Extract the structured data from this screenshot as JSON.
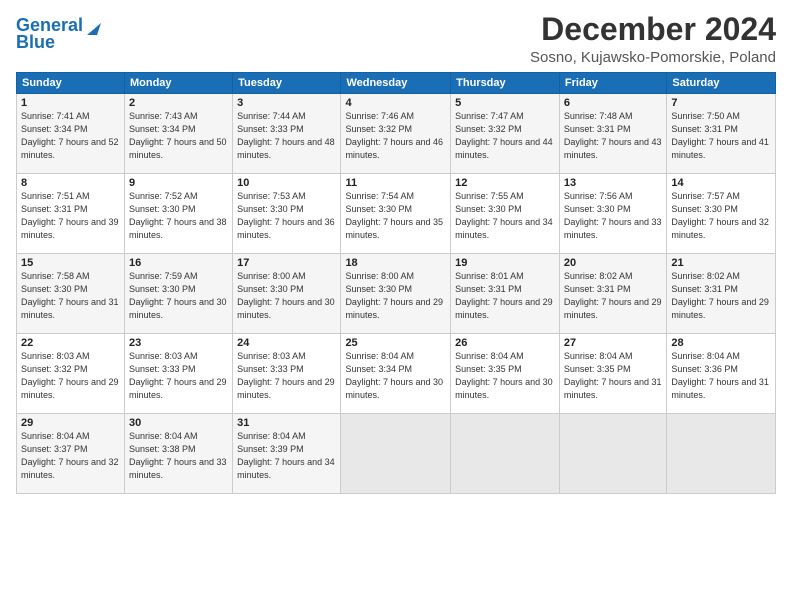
{
  "header": {
    "logo_line1": "General",
    "logo_line2": "Blue",
    "title": "December 2024",
    "subtitle": "Sosno, Kujawsko-Pomorskie, Poland"
  },
  "weekdays": [
    "Sunday",
    "Monday",
    "Tuesday",
    "Wednesday",
    "Thursday",
    "Friday",
    "Saturday"
  ],
  "weeks": [
    [
      {
        "day": "1",
        "sunrise": "Sunrise: 7:41 AM",
        "sunset": "Sunset: 3:34 PM",
        "daylight": "Daylight: 7 hours and 52 minutes."
      },
      {
        "day": "2",
        "sunrise": "Sunrise: 7:43 AM",
        "sunset": "Sunset: 3:34 PM",
        "daylight": "Daylight: 7 hours and 50 minutes."
      },
      {
        "day": "3",
        "sunrise": "Sunrise: 7:44 AM",
        "sunset": "Sunset: 3:33 PM",
        "daylight": "Daylight: 7 hours and 48 minutes."
      },
      {
        "day": "4",
        "sunrise": "Sunrise: 7:46 AM",
        "sunset": "Sunset: 3:32 PM",
        "daylight": "Daylight: 7 hours and 46 minutes."
      },
      {
        "day": "5",
        "sunrise": "Sunrise: 7:47 AM",
        "sunset": "Sunset: 3:32 PM",
        "daylight": "Daylight: 7 hours and 44 minutes."
      },
      {
        "day": "6",
        "sunrise": "Sunrise: 7:48 AM",
        "sunset": "Sunset: 3:31 PM",
        "daylight": "Daylight: 7 hours and 43 minutes."
      },
      {
        "day": "7",
        "sunrise": "Sunrise: 7:50 AM",
        "sunset": "Sunset: 3:31 PM",
        "daylight": "Daylight: 7 hours and 41 minutes."
      }
    ],
    [
      {
        "day": "8",
        "sunrise": "Sunrise: 7:51 AM",
        "sunset": "Sunset: 3:31 PM",
        "daylight": "Daylight: 7 hours and 39 minutes."
      },
      {
        "day": "9",
        "sunrise": "Sunrise: 7:52 AM",
        "sunset": "Sunset: 3:30 PM",
        "daylight": "Daylight: 7 hours and 38 minutes."
      },
      {
        "day": "10",
        "sunrise": "Sunrise: 7:53 AM",
        "sunset": "Sunset: 3:30 PM",
        "daylight": "Daylight: 7 hours and 36 minutes."
      },
      {
        "day": "11",
        "sunrise": "Sunrise: 7:54 AM",
        "sunset": "Sunset: 3:30 PM",
        "daylight": "Daylight: 7 hours and 35 minutes."
      },
      {
        "day": "12",
        "sunrise": "Sunrise: 7:55 AM",
        "sunset": "Sunset: 3:30 PM",
        "daylight": "Daylight: 7 hours and 34 minutes."
      },
      {
        "day": "13",
        "sunrise": "Sunrise: 7:56 AM",
        "sunset": "Sunset: 3:30 PM",
        "daylight": "Daylight: 7 hours and 33 minutes."
      },
      {
        "day": "14",
        "sunrise": "Sunrise: 7:57 AM",
        "sunset": "Sunset: 3:30 PM",
        "daylight": "Daylight: 7 hours and 32 minutes."
      }
    ],
    [
      {
        "day": "15",
        "sunrise": "Sunrise: 7:58 AM",
        "sunset": "Sunset: 3:30 PM",
        "daylight": "Daylight: 7 hours and 31 minutes."
      },
      {
        "day": "16",
        "sunrise": "Sunrise: 7:59 AM",
        "sunset": "Sunset: 3:30 PM",
        "daylight": "Daylight: 7 hours and 30 minutes."
      },
      {
        "day": "17",
        "sunrise": "Sunrise: 8:00 AM",
        "sunset": "Sunset: 3:30 PM",
        "daylight": "Daylight: 7 hours and 30 minutes."
      },
      {
        "day": "18",
        "sunrise": "Sunrise: 8:00 AM",
        "sunset": "Sunset: 3:30 PM",
        "daylight": "Daylight: 7 hours and 29 minutes."
      },
      {
        "day": "19",
        "sunrise": "Sunrise: 8:01 AM",
        "sunset": "Sunset: 3:31 PM",
        "daylight": "Daylight: 7 hours and 29 minutes."
      },
      {
        "day": "20",
        "sunrise": "Sunrise: 8:02 AM",
        "sunset": "Sunset: 3:31 PM",
        "daylight": "Daylight: 7 hours and 29 minutes."
      },
      {
        "day": "21",
        "sunrise": "Sunrise: 8:02 AM",
        "sunset": "Sunset: 3:31 PM",
        "daylight": "Daylight: 7 hours and 29 minutes."
      }
    ],
    [
      {
        "day": "22",
        "sunrise": "Sunrise: 8:03 AM",
        "sunset": "Sunset: 3:32 PM",
        "daylight": "Daylight: 7 hours and 29 minutes."
      },
      {
        "day": "23",
        "sunrise": "Sunrise: 8:03 AM",
        "sunset": "Sunset: 3:33 PM",
        "daylight": "Daylight: 7 hours and 29 minutes."
      },
      {
        "day": "24",
        "sunrise": "Sunrise: 8:03 AM",
        "sunset": "Sunset: 3:33 PM",
        "daylight": "Daylight: 7 hours and 29 minutes."
      },
      {
        "day": "25",
        "sunrise": "Sunrise: 8:04 AM",
        "sunset": "Sunset: 3:34 PM",
        "daylight": "Daylight: 7 hours and 30 minutes."
      },
      {
        "day": "26",
        "sunrise": "Sunrise: 8:04 AM",
        "sunset": "Sunset: 3:35 PM",
        "daylight": "Daylight: 7 hours and 30 minutes."
      },
      {
        "day": "27",
        "sunrise": "Sunrise: 8:04 AM",
        "sunset": "Sunset: 3:35 PM",
        "daylight": "Daylight: 7 hours and 31 minutes."
      },
      {
        "day": "28",
        "sunrise": "Sunrise: 8:04 AM",
        "sunset": "Sunset: 3:36 PM",
        "daylight": "Daylight: 7 hours and 31 minutes."
      }
    ],
    [
      {
        "day": "29",
        "sunrise": "Sunrise: 8:04 AM",
        "sunset": "Sunset: 3:37 PM",
        "daylight": "Daylight: 7 hours and 32 minutes."
      },
      {
        "day": "30",
        "sunrise": "Sunrise: 8:04 AM",
        "sunset": "Sunset: 3:38 PM",
        "daylight": "Daylight: 7 hours and 33 minutes."
      },
      {
        "day": "31",
        "sunrise": "Sunrise: 8:04 AM",
        "sunset": "Sunset: 3:39 PM",
        "daylight": "Daylight: 7 hours and 34 minutes."
      },
      null,
      null,
      null,
      null
    ]
  ]
}
